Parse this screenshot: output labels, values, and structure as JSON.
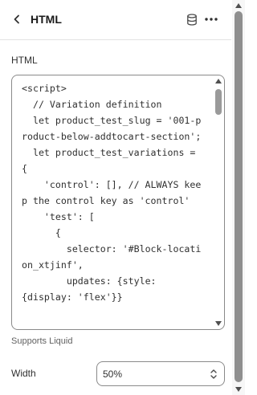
{
  "header": {
    "title": "HTML",
    "back_icon": "chevron-left-icon",
    "database_icon": "database-icon",
    "more_icon": "more-horizontal-icon"
  },
  "field": {
    "label": "HTML",
    "code": "<script>\n  // Variation definition\n  let product_test_slug = '001-product-below-addtocart-section';\n  let product_test_variations =\n{\n    'control': [], // ALWAYS keep the control key as 'control'\n    'test': [\n      {\n        selector: '#Block-location_xtjinf',\n        updates: {style:\n{display: 'flex'}}",
    "helper": "Supports Liquid"
  },
  "width": {
    "label": "Width",
    "value": "50%"
  },
  "colors": {
    "border": "#8a8a8a",
    "text": "#303030",
    "muted": "#616161"
  }
}
